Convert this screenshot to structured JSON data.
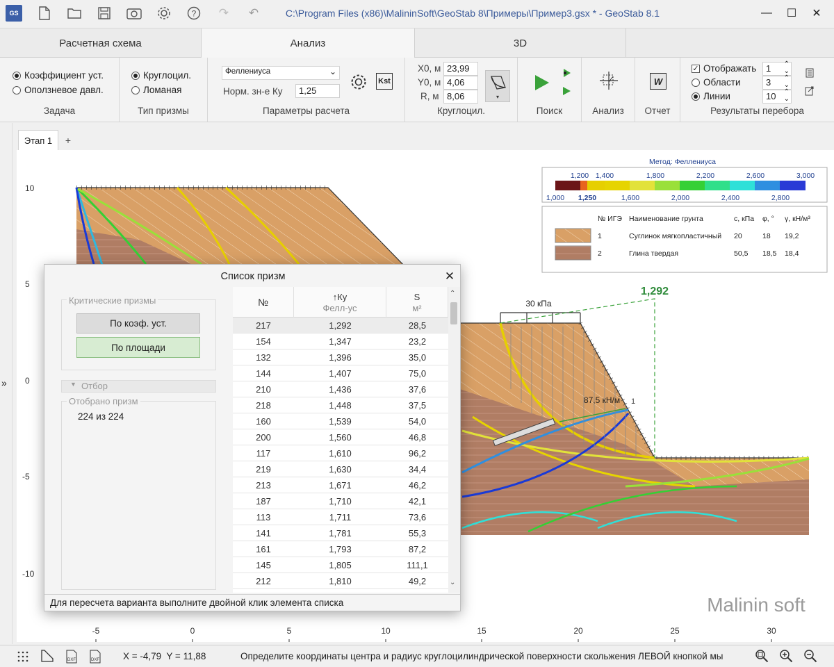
{
  "window": {
    "title": "C:\\Program Files (x86)\\MalininSoft\\GeoStab 8\\Примеры\\Пример3.gsx * - GeoStab 8.1",
    "app_badge": "GS"
  },
  "main_tabs": [
    {
      "label": "Расчетная схема",
      "active": false
    },
    {
      "label": "Анализ",
      "active": true
    },
    {
      "label": "3D",
      "active": false
    }
  ],
  "ribbon": {
    "task": {
      "label": "Задача",
      "options": [
        {
          "label": "Коэффициент уст.",
          "selected": true
        },
        {
          "label": "Оползневое давл.",
          "selected": false
        }
      ]
    },
    "prism_type": {
      "label": "Тип призмы",
      "options": [
        {
          "label": "Круглоцил.",
          "selected": true
        },
        {
          "label": "Ломаная",
          "selected": false
        }
      ]
    },
    "params": {
      "label": "Параметры расчета",
      "method_value": "Феллениуса",
      "norm_label": "Норм. зн-е Ку",
      "norm_value": "1,25",
      "kst_label": "Kst"
    },
    "circle": {
      "label": "Круглоцил.",
      "x0_label": "X0, м",
      "x0_value": "23,99",
      "y0_label": "Y0, м",
      "y0_value": "4,06",
      "r_label": "R, м",
      "r_value": "8,06"
    },
    "search": {
      "label": "Поиск"
    },
    "analysis": {
      "label": "Анализ"
    },
    "report": {
      "label": "Отчет",
      "icon_letter": "W"
    },
    "results": {
      "label": "Результаты перебора",
      "show_label": "Отображать",
      "show_checked": true,
      "show_value": "1",
      "areas_label": "Области",
      "areas_value": "3",
      "areas_selected": false,
      "lines_label": "Линии",
      "lines_value": "10",
      "lines_selected": true
    }
  },
  "doc_tabs": {
    "stage": "Этап 1",
    "add": "+"
  },
  "plot": {
    "method_title": "Метод: Феллениуса",
    "scale_top": [
      "1,200",
      "1,400",
      "1,800",
      "2,200",
      "2,600",
      "3,000"
    ],
    "scale_bottom": [
      "1,000",
      "1,250",
      "1,600",
      "2,000",
      "2,400",
      "2,800"
    ],
    "scale_colors": [
      "#6b1518",
      "#e8641e",
      "#e6cf00",
      "#e6d400",
      "#e2e23a",
      "#9ae03a",
      "#35d035",
      "#30df8a",
      "#2fe0d8",
      "#2f8fe0",
      "#2a3ad6"
    ],
    "soil_table": {
      "headers": [
        "№ ИГЭ",
        "Наименование грунта",
        "с, кПа",
        "φ, °",
        "γ, кН/м³"
      ],
      "rows": [
        {
          "num": "1",
          "name": "Суглинок мягкопластичный",
          "c": "20",
          "phi": "18",
          "gamma": "19,2",
          "color": "#d9a066"
        },
        {
          "num": "2",
          "name": "Глина твердая",
          "c": "50,5",
          "phi": "18,5",
          "gamma": "18,4",
          "color": "#b07d64"
        }
      ]
    },
    "critical_value": "1,292",
    "load_label": "30 кПа",
    "anchor_label": "87,5 кН/м",
    "anchor_num": "1",
    "y_ticks": [
      "10",
      "5",
      "0",
      "-5",
      "-10"
    ],
    "x_ticks": [
      "-5",
      "0",
      "5",
      "10",
      "15",
      "20",
      "25",
      "30"
    ],
    "watermark": "Malinin soft"
  },
  "dialog": {
    "title": "Список призм",
    "critical_group": "Критические призмы",
    "btn_by_coef": "По коэф. уст.",
    "btn_by_area": "По площади",
    "filter_label": "Отбор",
    "selected_group": "Отобрано призм",
    "selected_text": "224 из 224",
    "columns": [
      {
        "title": "№",
        "sub": ""
      },
      {
        "title": "↑Ку",
        "sub": "Фелл-ус"
      },
      {
        "title": "S",
        "sub": "м²"
      }
    ],
    "rows": [
      {
        "n": "217",
        "k": "1,292",
        "s": "28,5"
      },
      {
        "n": "154",
        "k": "1,347",
        "s": "23,2"
      },
      {
        "n": "132",
        "k": "1,396",
        "s": "35,0"
      },
      {
        "n": "144",
        "k": "1,407",
        "s": "75,0"
      },
      {
        "n": "210",
        "k": "1,436",
        "s": "37,6"
      },
      {
        "n": "218",
        "k": "1,448",
        "s": "37,5"
      },
      {
        "n": "160",
        "k": "1,539",
        "s": "54,0"
      },
      {
        "n": "200",
        "k": "1,560",
        "s": "46,8"
      },
      {
        "n": "117",
        "k": "1,610",
        "s": "96,2"
      },
      {
        "n": "219",
        "k": "1,630",
        "s": "34,4"
      },
      {
        "n": "213",
        "k": "1,671",
        "s": "46,2"
      },
      {
        "n": "187",
        "k": "1,710",
        "s": "42,1"
      },
      {
        "n": "113",
        "k": "1,711",
        "s": "73,6"
      },
      {
        "n": "141",
        "k": "1,781",
        "s": "55,3"
      },
      {
        "n": "161",
        "k": "1,793",
        "s": "87,2"
      },
      {
        "n": "145",
        "k": "1,805",
        "s": "111,1"
      },
      {
        "n": "212",
        "k": "1,810",
        "s": "49,2"
      }
    ],
    "hint": "Для пересчета варианта выполните двойной клик элемента списка"
  },
  "statusbar": {
    "coords": "X = -4,79  Y = 11,88",
    "message": "Определите координаты центра и радиус круглоцилиндрической поверхности скольжения ЛЕВОЙ кнопкой мы"
  }
}
